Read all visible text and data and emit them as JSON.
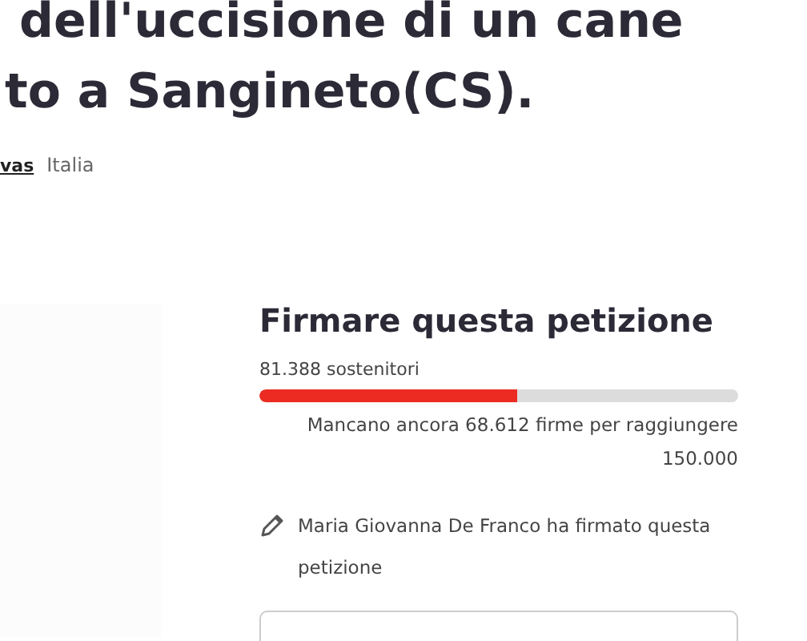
{
  "title_lines": [
    "dell'uccisione di un cane",
    "to a Sangineto(CS)."
  ],
  "author": {
    "name": "vas",
    "location": "Italia"
  },
  "sign": {
    "heading": "Firmare questa petizione",
    "supporters": "81.388 sostenitori",
    "level": 0.54,
    "remaining": "Mancano ancora 68.612 firme per raggiungere 150.000",
    "recent": "Maria Giovanna De Franco ha firmato questa petizione"
  }
}
